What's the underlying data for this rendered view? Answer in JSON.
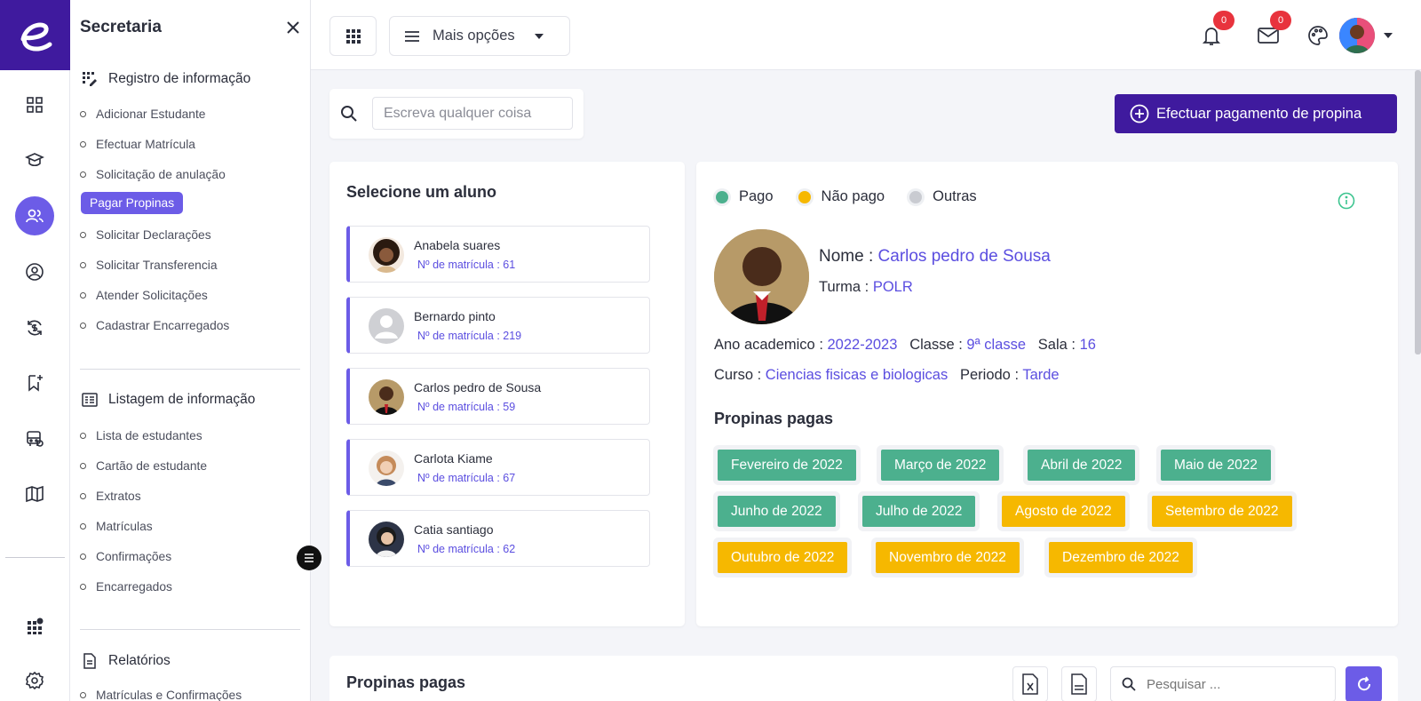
{
  "app": {
    "logo_letter": "e",
    "accent": "#6c5ce7",
    "brand": "#3f1a9e"
  },
  "rail": {
    "icons": [
      "dashboard-icon",
      "graduation-cap-icon",
      "users-icon",
      "user-circle-icon",
      "currency-exchange-icon",
      "bookmark-add-icon",
      "bus-icon",
      "book-map-icon",
      "apps-badge-icon",
      "settings-icon"
    ],
    "active": "users-icon"
  },
  "panel": {
    "title": "Secretaria",
    "section1": {
      "title": "Registro de informação",
      "items": [
        "Adicionar Estudante",
        "Efectuar Matrícula",
        "Solicitação de anulação",
        "Pagar Propinas",
        "Solicitar Declarações",
        "Solicitar Transferencia",
        "Atender Solicitações",
        "Cadastrar Encarregados"
      ]
    },
    "section2": {
      "title": "Listagem de informação",
      "items": [
        "Lista de estudantes",
        "Cartão de estudante",
        "Extratos",
        "Matrículas",
        "Confirmações",
        "Encarregados"
      ]
    },
    "section3": {
      "title": "Relatórios",
      "items": [
        "Matrículas e Confirmações"
      ]
    },
    "active_item": "Pagar Propinas"
  },
  "topbar": {
    "more_options": "Mais opções",
    "notifications_count": "0",
    "messages_count": "0"
  },
  "search": {
    "placeholder": "Escreva qualquer coisa"
  },
  "pay_button": "Efectuar pagamento de propina",
  "students": {
    "title": "Selecione um aluno",
    "list": [
      {
        "name": "Anabela suares",
        "matricula": "Nº de matrícula : 61"
      },
      {
        "name": "Bernardo pinto",
        "matricula": "Nº de matrícula : 219"
      },
      {
        "name": "Carlos pedro de Sousa",
        "matricula": "Nº de matrícula : 59"
      },
      {
        "name": "Carlota Kiame",
        "matricula": "Nº de matrícula : 67"
      },
      {
        "name": "Catia santiago",
        "matricula": "Nº de matrícula : 62"
      }
    ]
  },
  "legend": {
    "paid": "Pago",
    "unpaid": "Não pago",
    "other": "Outras",
    "paid_color": "#4cb08e",
    "unpaid_color": "#f6b800",
    "other_color": "#c9cbd1"
  },
  "student_detail": {
    "name_label": "Nome :",
    "name": "Carlos pedro de Sousa",
    "turma_label": "Turma :",
    "turma": "POLR",
    "ano_label": "Ano academico :",
    "ano": "2022-2023",
    "classe_label": "Classe :",
    "classe": "9ª classe",
    "sala_label": "Sala :",
    "sala": "16",
    "curso_label": "Curso :",
    "curso": "Ciencias fisicas e biologicas",
    "periodo_label": "Periodo :",
    "periodo": "Tarde",
    "propinas_title": "Propinas pagas",
    "months": [
      {
        "label": "Fevereiro de 2022",
        "status": "paid"
      },
      {
        "label": "Março de 2022",
        "status": "paid"
      },
      {
        "label": "Abril de 2022",
        "status": "paid"
      },
      {
        "label": "Maio de 2022",
        "status": "paid"
      },
      {
        "label": "Junho de 2022",
        "status": "paid"
      },
      {
        "label": "Julho de 2022",
        "status": "paid"
      },
      {
        "label": "Agosto de 2022",
        "status": "unpaid"
      },
      {
        "label": "Setembro de 2022",
        "status": "unpaid"
      },
      {
        "label": "Outubro de 2022",
        "status": "unpaid"
      },
      {
        "label": "Novembro de 2022",
        "status": "unpaid"
      },
      {
        "label": "Dezembro de 2022",
        "status": "unpaid"
      }
    ]
  },
  "bottom": {
    "title": "Propinas pagas",
    "search_placeholder": "Pesquisar ...",
    "export_excel": "excel-export-icon",
    "export_csv": "csv-export-icon"
  }
}
